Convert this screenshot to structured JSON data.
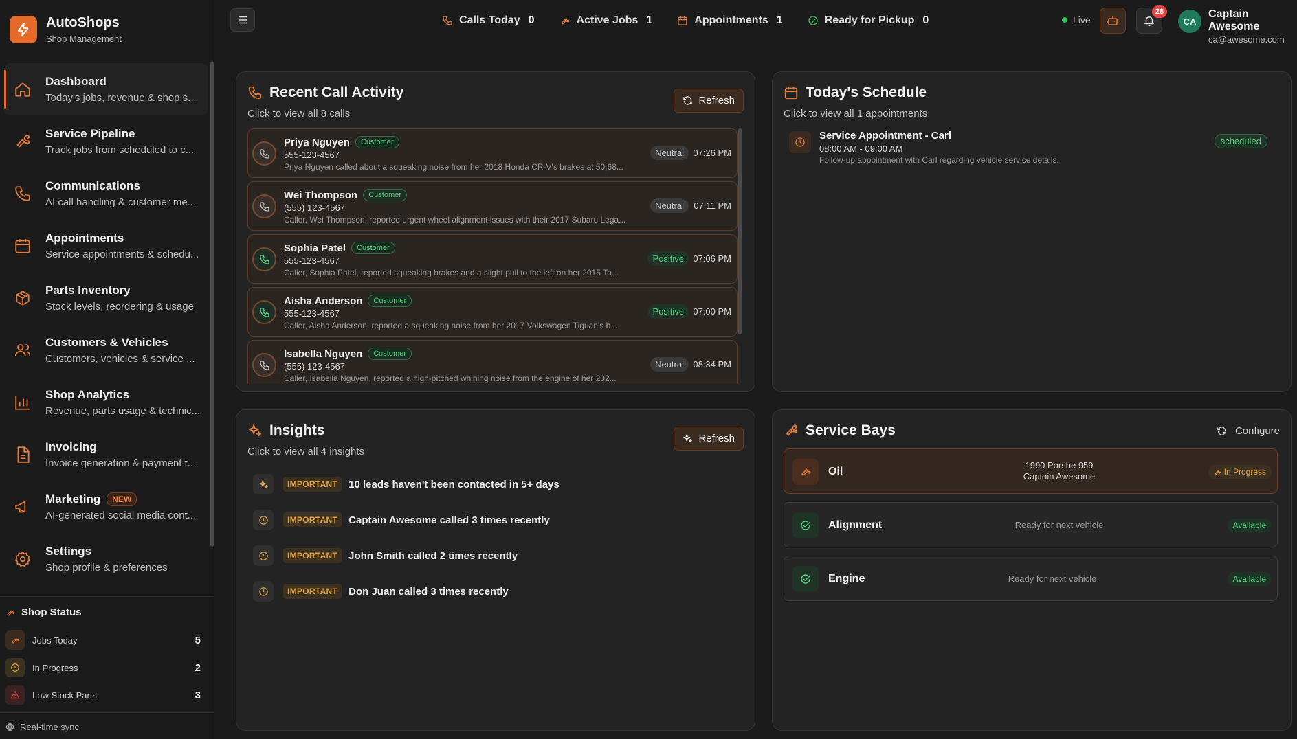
{
  "brand": {
    "name": "AutoShops",
    "subtitle": "Shop Management"
  },
  "nav": [
    {
      "title": "Dashboard",
      "desc": "Today's jobs, revenue & shop s...",
      "icon": "home-icon",
      "active": true
    },
    {
      "title": "Service Pipeline",
      "desc": "Track jobs from scheduled to c...",
      "icon": "wrench-icon"
    },
    {
      "title": "Communications",
      "desc": "AI call handling & customer me...",
      "icon": "phone-icon"
    },
    {
      "title": "Appointments",
      "desc": "Service appointments & schedu...",
      "icon": "calendar-icon"
    },
    {
      "title": "Parts Inventory",
      "desc": "Stock levels, reordering & usage",
      "icon": "box-icon"
    },
    {
      "title": "Customers & Vehicles",
      "desc": "Customers, vehicles & service ...",
      "icon": "users-icon"
    },
    {
      "title": "Shop Analytics",
      "desc": "Revenue, parts usage & technic...",
      "icon": "bar-chart-icon"
    },
    {
      "title": "Invoicing",
      "desc": "Invoice generation & payment t...",
      "icon": "document-icon"
    },
    {
      "title": "Marketing",
      "desc": "AI-generated social media cont...",
      "icon": "megaphone-icon",
      "badge": "NEW"
    },
    {
      "title": "Settings",
      "desc": "Shop profile & preferences",
      "icon": "gear-icon"
    }
  ],
  "shop_status": {
    "title": "Shop Status",
    "items": [
      {
        "label": "Jobs Today",
        "value": "5"
      },
      {
        "label": "In Progress",
        "value": "2"
      },
      {
        "label": "Low Stock Parts",
        "value": "3"
      }
    ]
  },
  "sync_label": "Real-time sync",
  "topbar": {
    "stats": [
      {
        "label": "Calls Today",
        "value": "0"
      },
      {
        "label": "Active Jobs",
        "value": "1"
      },
      {
        "label": "Appointments",
        "value": "1"
      },
      {
        "label": "Ready for Pickup",
        "value": "0"
      }
    ],
    "live_label": "Live",
    "notification_count": "28",
    "user": {
      "initials": "CA",
      "name": "Captain Awesome",
      "email": "ca@awesome.com"
    }
  },
  "calls_panel": {
    "title": "Recent Call Activity",
    "subtitle": "Click to view all 8 calls",
    "refresh_label": "Refresh",
    "calls": [
      {
        "name": "Priya Nguyen",
        "tag": "Customer",
        "phone": "555-123-4567",
        "summary": "Priya Nguyen called about a squeaking noise from her 2018 Honda CR-V's brakes at 50,68...",
        "sentiment": "Neutral",
        "time": "07:26 PM"
      },
      {
        "name": "Wei Thompson",
        "tag": "Customer",
        "phone": "(555) 123-4567",
        "summary": "Caller, Wei Thompson, reported urgent wheel alignment issues with their 2017 Subaru Lega...",
        "sentiment": "Neutral",
        "time": "07:11 PM"
      },
      {
        "name": "Sophia Patel",
        "tag": "Customer",
        "phone": "555-123-4567",
        "summary": "Caller, Sophia Patel, reported squeaking brakes and a slight pull to the left on her 2015 To...",
        "sentiment": "Positive",
        "time": "07:06 PM"
      },
      {
        "name": "Aisha Anderson",
        "tag": "Customer",
        "phone": "555-123-4567",
        "summary": "Caller, Aisha Anderson, reported a squeaking noise from her 2017 Volkswagen Tiguan's b...",
        "sentiment": "Positive",
        "time": "07:00 PM"
      },
      {
        "name": "Isabella Nguyen",
        "tag": "Customer",
        "phone": "(555) 123-4567",
        "summary": "Caller, Isabella Nguyen, reported a high-pitched whining noise from the engine of her 202...",
        "sentiment": "Neutral",
        "time": "08:34 PM"
      }
    ]
  },
  "schedule_panel": {
    "title": "Today's Schedule",
    "subtitle": "Click to view all 1 appointments",
    "appointment": {
      "title": "Service Appointment - Carl",
      "time": "08:00 AM - 09:00 AM",
      "desc": "Follow-up appointment with Carl regarding vehicle service details.",
      "status": "scheduled"
    }
  },
  "insights_panel": {
    "title": "Insights",
    "subtitle": "Click to view all 4 insights",
    "refresh_label": "Refresh",
    "items": [
      {
        "tag": "IMPORTANT",
        "text": "10 leads haven't been contacted in 5+ days",
        "icon": "sparkle-icon"
      },
      {
        "tag": "IMPORTANT",
        "text": "Captain Awesome called 3 times recently",
        "icon": "alert-circle-icon"
      },
      {
        "tag": "IMPORTANT",
        "text": "John Smith called 2 times recently",
        "icon": "alert-circle-icon"
      },
      {
        "tag": "IMPORTANT",
        "text": "Don Juan called 3 times recently",
        "icon": "alert-circle-icon"
      }
    ]
  },
  "bays_panel": {
    "title": "Service Bays",
    "configure_label": "Configure",
    "bays": [
      {
        "name": "Oil",
        "vehicle": "1990 Porshe 959",
        "customer": "Captain Awesome",
        "status": "In Progress",
        "state": "busy"
      },
      {
        "name": "Alignment",
        "info": "Ready for next vehicle",
        "status": "Available",
        "state": "free"
      },
      {
        "name": "Engine",
        "info": "Ready for next vehicle",
        "status": "Available",
        "state": "free"
      }
    ]
  },
  "colors": {
    "accent": "#e46a2a",
    "background": "#1b1b1b",
    "panel": "#232323",
    "success": "#4fcf7d",
    "warning": "#e3a33c",
    "danger": "#e14545"
  }
}
